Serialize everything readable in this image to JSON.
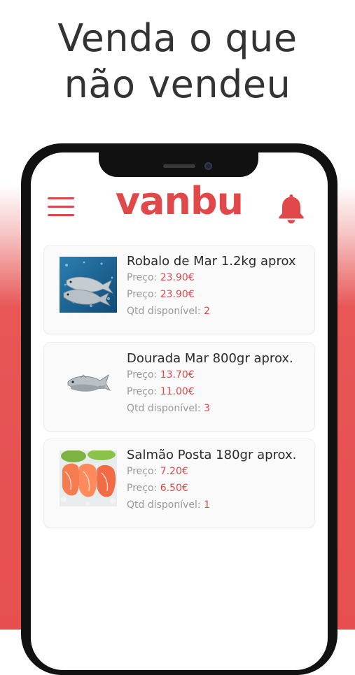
{
  "headline": {
    "line1": "Venda o que",
    "line2": "não vendeu"
  },
  "app": {
    "logo": "vanbu",
    "accent": "#e1484a"
  },
  "icons": {
    "menu": "hamburger-menu-icon",
    "notifications": "bell-icon"
  },
  "products": [
    {
      "title": "Robalo de Mar 1.2kg aprox",
      "price_label": "Preço:",
      "price_original": "23.90€",
      "price_current": "23.90€",
      "qty_label": "Qtd disponível:",
      "qty": "2"
    },
    {
      "title": "Dourada Mar 800gr aprox.",
      "price_label": "Preço:",
      "price_original": "13.70€",
      "price_current": "11.00€",
      "qty_label": "Qtd disponível:",
      "qty": "3"
    },
    {
      "title": "Salmão Posta 180gr aprox.",
      "price_label": "Preço:",
      "price_original": "7.20€",
      "price_current": "6.50€",
      "qty_label": "Qtd disponível:",
      "qty": "1"
    }
  ]
}
